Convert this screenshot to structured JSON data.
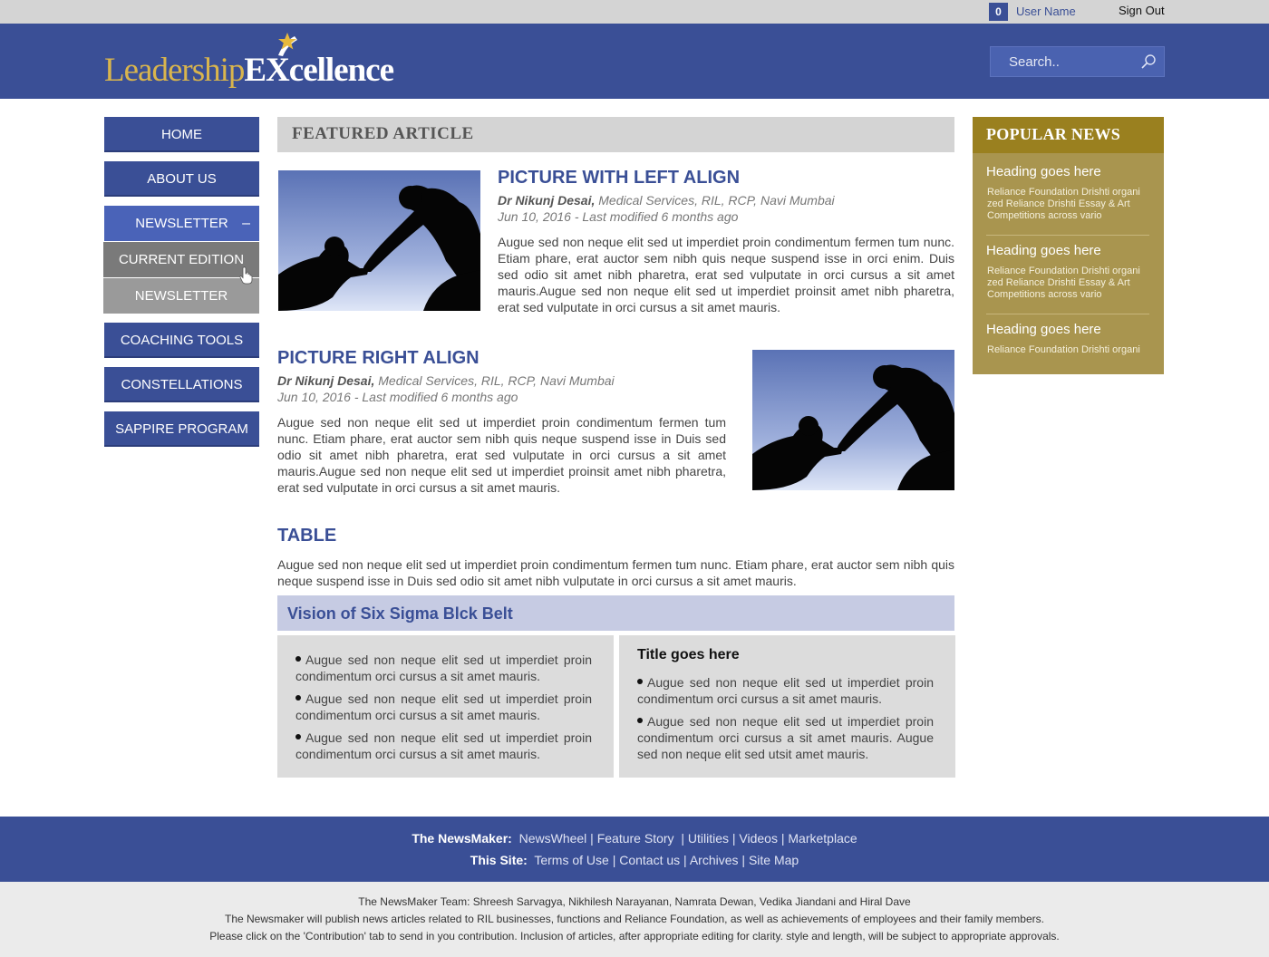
{
  "topbar": {
    "notification_count": "0",
    "user_name": "User Name",
    "sign_out": "Sign Out"
  },
  "header": {
    "logo_leadership": "Leadership",
    "logo_excellence": "EXcellence",
    "search_placeholder": "Search.."
  },
  "nav": {
    "items": [
      {
        "label": "HOME"
      },
      {
        "label": "ABOUT US"
      },
      {
        "label": "NEWSLETTER",
        "expanded": true,
        "toggle": "–"
      },
      {
        "label": "COACHING TOOLS"
      },
      {
        "label": "CONSTELLATIONS"
      },
      {
        "label": "SAPPIRE PROGRAM"
      }
    ],
    "newsletter_sub": [
      {
        "label": "CURRENT EDITION"
      },
      {
        "label": "NEWSLETTER ARCHIVE"
      }
    ]
  },
  "main": {
    "section_title": "FEATURED ARTICLE",
    "article1": {
      "title": "PICTURE WITH LEFT ALIGN",
      "author_name": "Dr Nikunj Desai,",
      "author_info": " Medical Services, RIL, RCP, Navi Mumbai",
      "date": "Jun 10, 2016 - Last modified 6 months ago",
      "body": "Augue sed non neque elit sed ut imperdiet proin condimentum fermen tum nunc. Etiam phare, erat auctor sem nibh quis neque suspend isse in orci enim. Duis sed odio sit amet nibh pharetra, erat sed vulputate in orci cursus a sit amet mauris.Augue sed non neque elit sed ut imperdiet proinsit amet nibh pharetra, erat sed vulputate in orci cursus a sit amet mauris."
    },
    "article2": {
      "title": "PICTURE RIGHT ALIGN",
      "author_name": "Dr Nikunj Desai,",
      "author_info": " Medical Services, RIL, RCP, Navi Mumbai",
      "date": "Jun 10, 2016 - Last modified 6 months ago",
      "body": "Augue sed non neque elit sed ut imperdiet proin condimentum fermen tum nunc. Etiam phare, erat auctor sem nibh quis neque suspend isse in Duis sed odio sit amet nibh pharetra, erat sed vulputate in orci cursus a sit amet mauris.Augue sed non neque elit sed ut imperdiet proinsit amet nibh pharetra, erat sed vulputate in orci cursus a sit amet mauris."
    },
    "table": {
      "title": "TABLE",
      "description": "Augue sed non neque elit sed ut imperdiet proin condimentum fermen tum nunc. Etiam phare, erat auctor sem nibh quis neque suspend isse in Duis sed odio sit amet nibh vulputate in orci cursus a sit amet mauris.",
      "vision_title": "Vision of Six Sigma Blck Belt",
      "left_bullets": [
        "Augue sed non neque elit sed ut imperdiet proin condimentum orci cursus a sit amet mauris.",
        "Augue sed non neque elit sed ut imperdiet proin condimentum orci cursus a sit amet mauris.",
        "Augue sed non neque elit sed ut imperdiet proin condimentum orci cursus a sit amet mauris."
      ],
      "right_title": "Title goes here",
      "right_bullets": [
        "Augue sed non neque elit sed ut imperdiet proin condimentum orci cursus a sit amet mauris.",
        "Augue sed non neque elit sed ut imperdiet proin condimentum orci cursus a sit amet mauris.  Augue sed non neque elit sed utsit amet mauris."
      ]
    }
  },
  "popular": {
    "title": "POPULAR NEWS",
    "items": [
      {
        "heading": "Heading goes here",
        "text": "Reliance Foundation Drishti organi zed Reliance Drishti Essay & Art Competitions across vario"
      },
      {
        "heading": "Heading goes here",
        "text": "Reliance Foundation Drishti organi zed Reliance Drishti Essay & Art Competitions across vario"
      },
      {
        "heading": "Heading goes here",
        "text": "Reliance Foundation Drishti organi"
      }
    ]
  },
  "footer": {
    "newsmaker_label": "The NewsMaker:",
    "newsmaker_links": [
      "NewsWheel",
      "Feature Story",
      "Utilities",
      "Videos",
      "Marketplace"
    ],
    "site_label": "This Site:",
    "site_links": [
      "Terms of Use",
      "Contact us",
      "Archives",
      "Site Map"
    ],
    "team": "The NewsMaker Team: Shreesh Sarvagya, Nikhilesh Narayanan, Namrata Dewan, Vedika Jiandani and Hiral Dave",
    "note1": "The Newsmaker will publish news articles related to RIL businesses, functions and Reliance Foundation, as well as achievements of employees and their family members.",
    "note2": "Please click on the 'Contribution' tab to send in you contribution. Inclusion of articles, after appropriate editing for clarity. style and length, will be subject to appropriate approvals."
  }
}
